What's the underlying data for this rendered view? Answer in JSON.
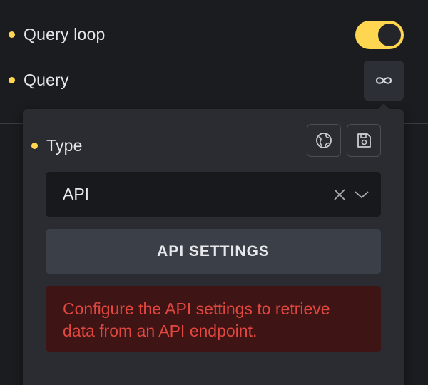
{
  "controls": {
    "query_loop": {
      "label": "Query loop",
      "enabled": true
    },
    "query": {
      "label": "Query",
      "icon": "infinity-icon"
    }
  },
  "popover": {
    "type_label": "Type",
    "icons": [
      "globe-icon",
      "save-icon"
    ],
    "select": {
      "value": "API",
      "icons": [
        "clear-icon",
        "chevron-down-icon"
      ]
    },
    "api_settings_button": "API SETTINGS",
    "notice": "Configure the API settings to retrieve data from an API endpoint."
  },
  "colors": {
    "accent": "#ffd64f",
    "background": "#1b1c20",
    "panel": "#2a2c31",
    "error_text": "#e1473f",
    "error_bg": "#3f1414"
  }
}
